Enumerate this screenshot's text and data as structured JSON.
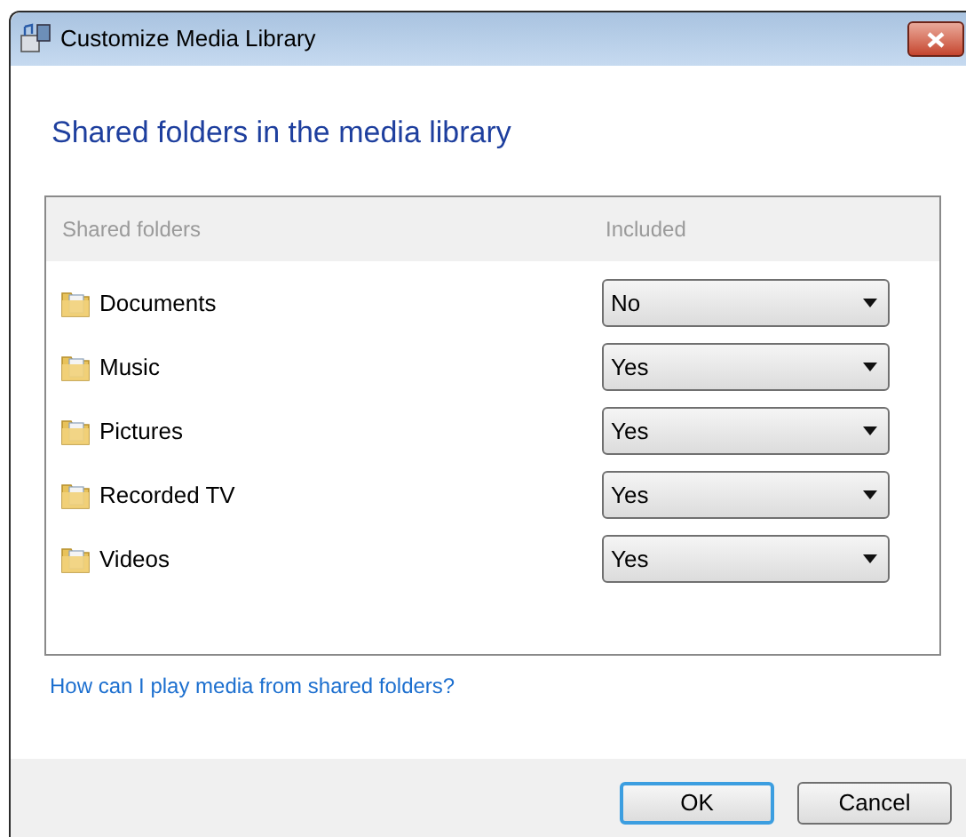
{
  "window": {
    "title": "Customize Media Library"
  },
  "heading": "Shared folders in the media library",
  "table": {
    "columns": [
      "Shared folders",
      "Included"
    ],
    "rows": [
      {
        "folder": "Documents",
        "included": "No"
      },
      {
        "folder": "Music",
        "included": "Yes"
      },
      {
        "folder": "Pictures",
        "included": "Yes"
      },
      {
        "folder": "Recorded TV",
        "included": "Yes"
      },
      {
        "folder": "Videos",
        "included": "Yes"
      }
    ]
  },
  "help_link": "How can I play media from shared folders?",
  "buttons": [
    {
      "label": "OK",
      "default": true
    },
    {
      "label": "Cancel",
      "default": false
    }
  ]
}
